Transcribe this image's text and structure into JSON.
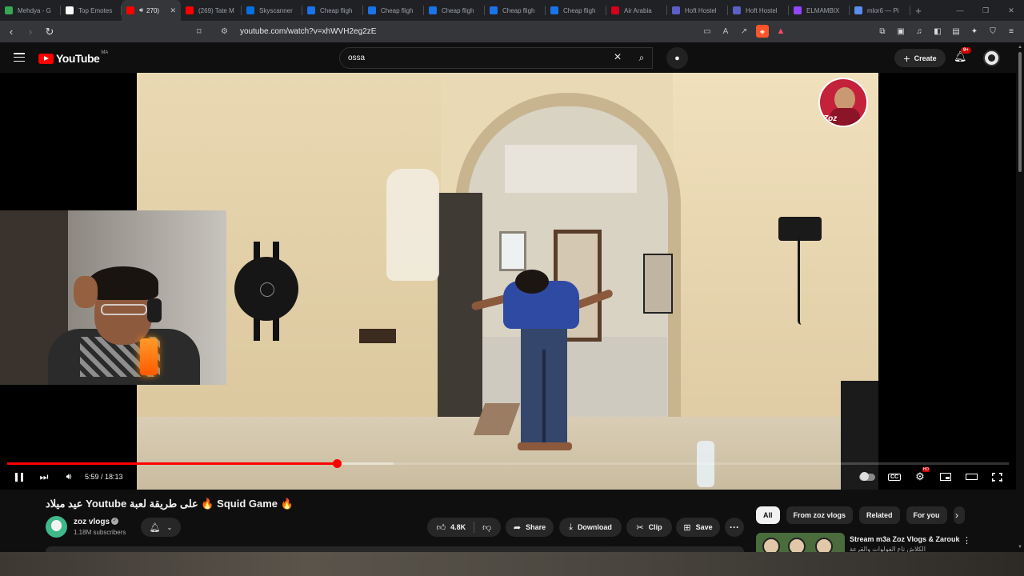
{
  "browser": {
    "tabs": [
      {
        "title": "Mehdya - G",
        "fav_color": "#34a853",
        "active": false
      },
      {
        "title": "Top Emotes",
        "fav_color": "#ffffff",
        "active": false
      },
      {
        "title": "270)",
        "fav_color": "#ff0000",
        "active": true
      },
      {
        "title": "(269) Tate M",
        "fav_color": "#ff0000",
        "active": false
      },
      {
        "title": "Skyscanner",
        "fav_color": "#0770e3",
        "active": false
      },
      {
        "title": "Cheap fligh",
        "fav_color": "#1a73e8",
        "active": false
      },
      {
        "title": "Cheap fligh",
        "fav_color": "#1a73e8",
        "active": false
      },
      {
        "title": "Cheap fligh",
        "fav_color": "#1a73e8",
        "active": false
      },
      {
        "title": "Cheap fligh",
        "fav_color": "#1a73e8",
        "active": false
      },
      {
        "title": "Cheap fligh",
        "fav_color": "#1a73e8",
        "active": false
      },
      {
        "title": "Air Arabia",
        "fav_color": "#d6001c",
        "active": false
      },
      {
        "title": "Hoft Hostel",
        "fav_color": "#5b5fc7",
        "active": false
      },
      {
        "title": "Hoft Hostel",
        "fav_color": "#5b5fc7",
        "active": false
      },
      {
        "title": "ELMAMBIX",
        "fav_color": "#9146ff",
        "active": false
      },
      {
        "title": "mlor6 — Pi",
        "fav_color": "#5b8def",
        "active": false
      }
    ],
    "new_tab": "+",
    "url": "youtube.com/watch?v=xhWVH2eg2zE"
  },
  "youtube": {
    "logo_text": "YouTube",
    "country_code": "MA",
    "search_query": "ossa",
    "create_label": "Create",
    "notification_badge": "9+"
  },
  "player": {
    "time": "5:59 / 18:13",
    "progress_fraction": 0.329,
    "buffered_fraction": 0.386,
    "watermark_text": "Zoz"
  },
  "video": {
    "title": "عيد ميلاد Youtube على طريقة لعبة 🔥 Squid Game 🔥",
    "channel_name": "zoz vlogs",
    "subscribers": "1.18M subscribers",
    "likes": "4.8K",
    "share_label": "Share",
    "download_label": "Download",
    "clip_label": "Clip",
    "save_label": "Save"
  },
  "sidebar": {
    "chips": [
      "All",
      "From zoz vlogs",
      "Related",
      "For you"
    ],
    "rec_title": "Stream m3a Zoz Vlogs & Zarouk",
    "rec_sub": "الكلاش تاع الفولوات والقرعة"
  },
  "colors": {
    "accent_red": "#ff0000",
    "yt_bg": "#0f0f0f"
  }
}
